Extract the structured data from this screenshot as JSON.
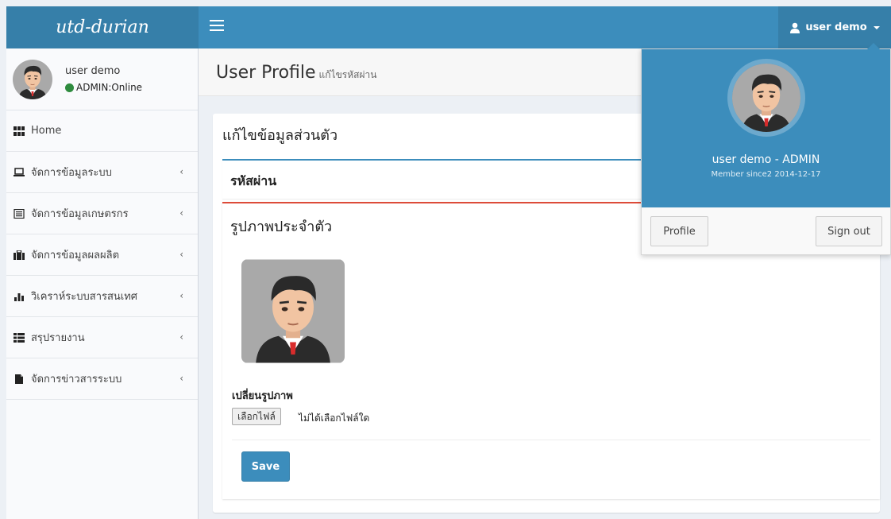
{
  "app": {
    "logo": "utd-durian"
  },
  "topbar": {
    "user_label": "user demo"
  },
  "sidebar": {
    "user_name": "user demo",
    "user_status": "ADMIN:Online",
    "items": [
      {
        "label": "Home",
        "icon": "grid-icon"
      },
      {
        "label": "จัดการข้อมูลระบบ",
        "icon": "laptop-icon"
      },
      {
        "label": "จัดการข้อมูลเกษตรกร",
        "icon": "list-icon"
      },
      {
        "label": "จัดการข้อมูลผลผลิต",
        "icon": "briefcase-icon"
      },
      {
        "label": "วิเคราห์ระบบสารสนเทศ",
        "icon": "bar-chart-icon"
      },
      {
        "label": "สรุปรายงาน",
        "icon": "table-icon"
      },
      {
        "label": "จัดการข่าวสารระบบ",
        "icon": "file-icon"
      }
    ]
  },
  "header": {
    "title": "User Profile",
    "subtitle": "แก้ไขรหัสผ่าน"
  },
  "main": {
    "box_title": "แก้ไขข้อมูลส่วนตัว",
    "password_panel_title": "รหัสผ่าน",
    "picture_panel_title": "รูปภาพประจำตัว",
    "change_picture_label": "เปลี่ยนรูปภาพ",
    "file_button_label": "เลือกไฟล์",
    "file_status": "ไม่ได้เลือกไฟล์ใด",
    "save_label": "Save"
  },
  "dropdown": {
    "name": "user demo - ADMIN",
    "member_since": "Member since2 2014-12-17",
    "profile_label": "Profile",
    "signout_label": "Sign out"
  },
  "colors": {
    "primary": "#3c8dbc",
    "primary_dark": "#367fa9",
    "danger": "#dd4b39",
    "online": "#2e8b3e"
  }
}
